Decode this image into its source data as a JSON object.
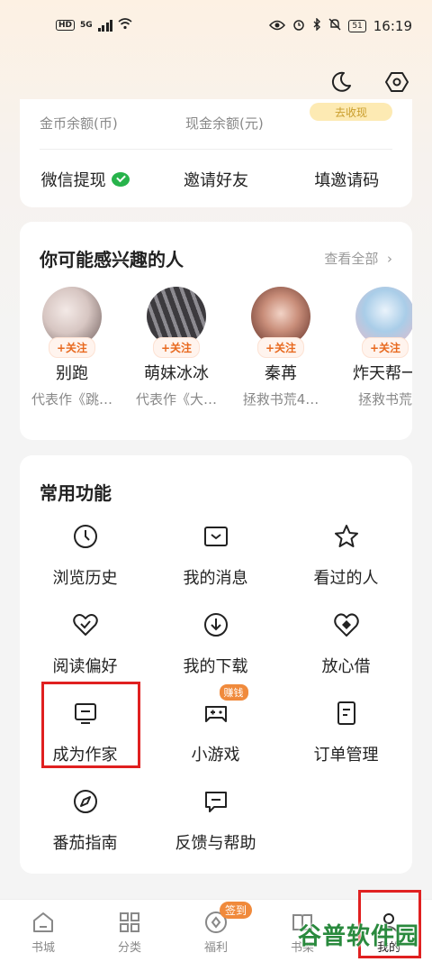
{
  "status_bar": {
    "hd": "HD",
    "network": "5G",
    "battery": "51",
    "time": "16:19"
  },
  "coins": {
    "coin_label": "金币余额(币)",
    "cash_label": "现金余额(元)",
    "badge": "去收现"
  },
  "actions": [
    {
      "label": "微信提现"
    },
    {
      "label": "邀请好友"
    },
    {
      "label": "填邀请码"
    }
  ],
  "interest": {
    "title": "你可能感兴趣的人",
    "view_all": "查看全部",
    "people": [
      {
        "name": "别跑",
        "desc": "代表作《跳…",
        "follow": "+关注"
      },
      {
        "name": "萌妹冰冰",
        "desc": "代表作《大…",
        "follow": "+关注"
      },
      {
        "name": "秦苒",
        "desc": "拯救书荒4…",
        "follow": "+关注"
      },
      {
        "name": "炸天帮一",
        "desc": "拯救书荒",
        "follow": "+关注"
      }
    ]
  },
  "functions": {
    "title": "常用功能",
    "items": [
      {
        "label": "浏览历史",
        "icon": "clock-icon"
      },
      {
        "label": "我的消息",
        "icon": "message-icon"
      },
      {
        "label": "看过的人",
        "icon": "star-icon"
      },
      {
        "label": "阅读偏好",
        "icon": "heart-check-icon"
      },
      {
        "label": "我的下载",
        "icon": "download-icon"
      },
      {
        "label": "放心借",
        "icon": "loan-icon"
      },
      {
        "label": "成为作家",
        "icon": "monitor-icon"
      },
      {
        "label": "小游戏",
        "icon": "gamepad-icon",
        "badge": "赚钱"
      },
      {
        "label": "订单管理",
        "icon": "document-icon"
      },
      {
        "label": "番茄指南",
        "icon": "compass-icon"
      },
      {
        "label": "反馈与帮助",
        "icon": "feedback-icon"
      }
    ]
  },
  "tabbar": {
    "tabs": [
      {
        "label": "书城"
      },
      {
        "label": "分类"
      },
      {
        "label": "福利",
        "badge": "签到"
      },
      {
        "label": "书架"
      },
      {
        "label": "我的"
      }
    ]
  },
  "watermark": "谷普软件园",
  "colors": {
    "accent": "#f08a3c",
    "highlight_box": "#e02020",
    "wechat": "#27b34b"
  }
}
